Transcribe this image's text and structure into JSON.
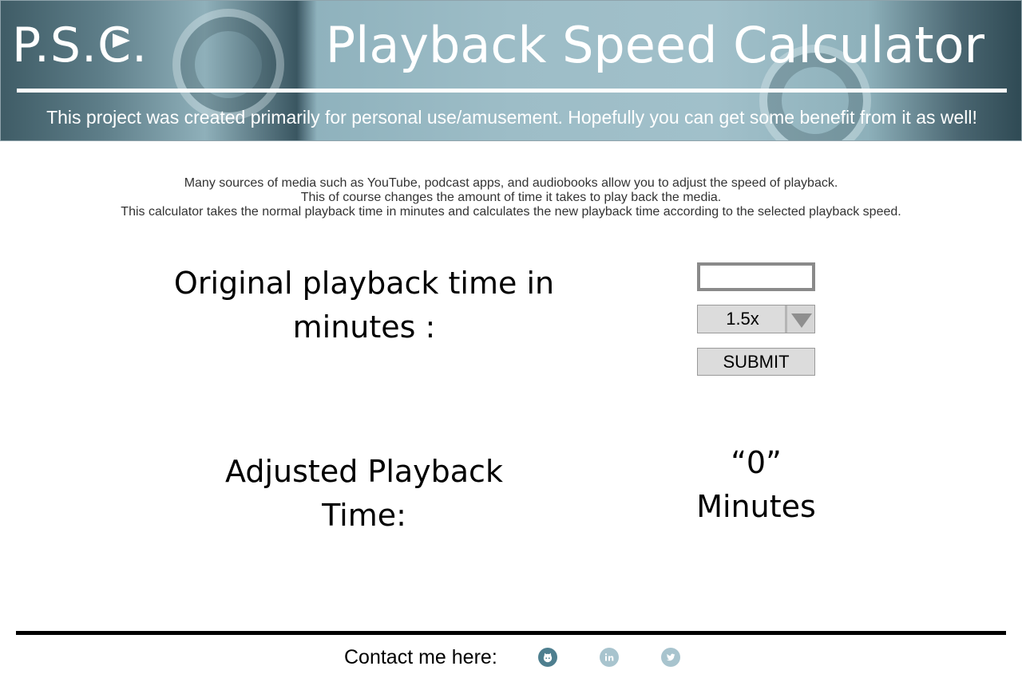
{
  "header": {
    "logo_text": "P.S.C.",
    "title": "Playback Speed Calculator",
    "tagline": "This project was created primarily for personal use/amusement. Hopefully you can get some benefit from it as well!"
  },
  "intro": {
    "lines": [
      "Many sources of media such as YouTube, podcast apps, and audiobooks allow you to adjust the speed of playback.",
      "This of course changes the amount of time it takes to play back the media.",
      "This calculator takes the normal playback time in minutes and calculates the new playback time according to the selected playback speed."
    ]
  },
  "form": {
    "original_label_line1": "Original playback time in",
    "original_label_line2": "minutes :",
    "minutes_value": "",
    "speed_selected": "1.5x",
    "submit_label": "SUBMIT"
  },
  "result": {
    "label_line1": "Adjusted Playback",
    "label_line2": "Time:",
    "value": "“0”",
    "unit": "Minutes"
  },
  "footer": {
    "contact_label": "Contact me here:",
    "social_icons": [
      "github-icon",
      "linkedin-icon",
      "twitter-icon"
    ]
  },
  "colors": {
    "header_tint": "#9dbdc7",
    "icon_active": "#4e7f8f",
    "icon_muted": "#a8c4ce",
    "footer_rule": "#000000"
  }
}
